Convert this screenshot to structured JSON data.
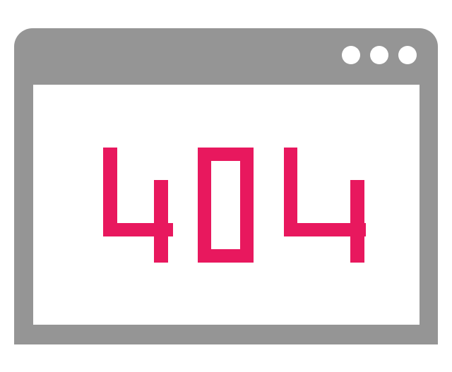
{
  "window": {
    "title_controls": [
      "dot",
      "dot",
      "dot"
    ],
    "frame_color": "#959595",
    "accent_color": "#E8185E"
  },
  "error": {
    "code": "404"
  },
  "icons": {
    "window_controls": "more-horizontal-dots-icon"
  }
}
